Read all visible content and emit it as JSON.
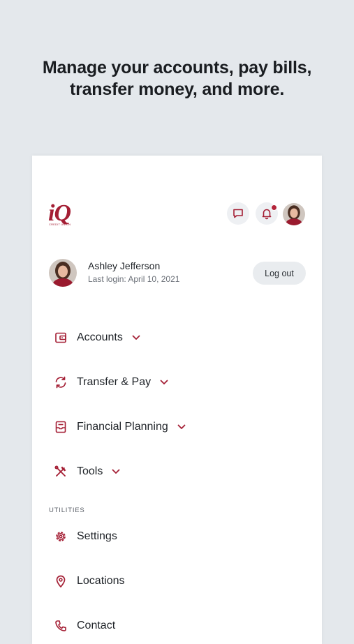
{
  "headline": {
    "line1": "Manage your accounts, pay bills,",
    "line2": "transfer money, and more."
  },
  "brand": {
    "logo_text": "iQ",
    "logo_subtext": "CREDIT UNION",
    "accent_color": "#a41e34"
  },
  "header": {
    "icons": [
      "chat-icon",
      "bell-icon",
      "avatar"
    ],
    "has_notification": true
  },
  "profile": {
    "name": "Ashley Jefferson",
    "last_login": "Last login: April 10, 2021",
    "logout_label": "Log out"
  },
  "nav": {
    "items": [
      {
        "label": "Accounts",
        "icon": "wallet-icon"
      },
      {
        "label": "Transfer & Pay",
        "icon": "transfer-icon"
      },
      {
        "label": "Financial Planning",
        "icon": "planning-icon"
      },
      {
        "label": "Tools",
        "icon": "tools-icon"
      }
    ]
  },
  "utilities": {
    "section_label": "UTILITIES",
    "items": [
      {
        "label": "Settings",
        "icon": "gear-icon"
      },
      {
        "label": "Locations",
        "icon": "location-pin-icon"
      },
      {
        "label": "Contact",
        "icon": "phone-icon"
      }
    ]
  }
}
